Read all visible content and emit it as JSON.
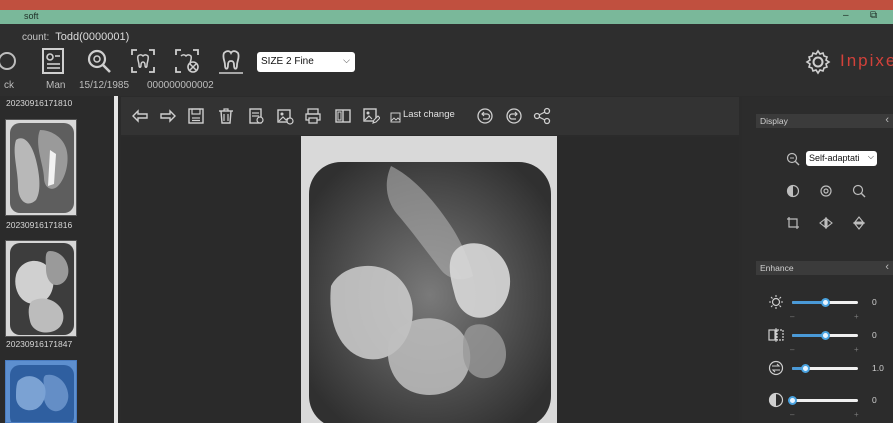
{
  "window": {
    "title": "soft",
    "minimize": "–",
    "restore": "⧉"
  },
  "header": {
    "account_label": "count:",
    "account_name": "Todd(0000001)",
    "size_select": "SIZE 2 Fine",
    "brand": "Inpixe",
    "patient": {
      "back": "ck",
      "gender": "Man",
      "dob": "15/12/1985",
      "id": "000000000002"
    }
  },
  "thumbnails": [
    {
      "caption": "20230916171810"
    },
    {
      "caption": "20230916171816"
    },
    {
      "caption": "20230916171847"
    },
    {
      "caption": ""
    }
  ],
  "toolbar": {
    "icons": [
      "arrow-left-icon",
      "arrow-right-icon",
      "save-icon",
      "trash-icon",
      "report-icon",
      "export-icon",
      "print-icon",
      "compare-icon",
      "edit-image-icon"
    ],
    "last_change_label": "Last change",
    "extra_icons": [
      "undo-icon",
      "redo-icon",
      "share-icon"
    ]
  },
  "display_panel": {
    "title": "Display",
    "select_value": "Self-adaptati",
    "icons": [
      "contrast-icon",
      "focus-icon",
      "zoom-icon",
      "crop-icon",
      "flip-horizontal-icon",
      "flip-vertical-icon"
    ]
  },
  "enhance_panel": {
    "title": "Enhance",
    "sliders": [
      {
        "name": "brightness",
        "icon": "brightness-icon",
        "value": "0",
        "position": 0.5
      },
      {
        "name": "sharpness",
        "icon": "sharpness-icon",
        "value": "0",
        "position": 0.5
      },
      {
        "name": "gamma",
        "icon": "gamma-icon",
        "value": "1.0",
        "position": 0.2
      },
      {
        "name": "contrast",
        "icon": "contrast-icon",
        "value": "0",
        "position": 0.0
      }
    ],
    "minus": "–",
    "plus": "+"
  },
  "colors": {
    "brand": "#d2413a",
    "accent": "#4a9ad8",
    "titlebar": "#7ab89a",
    "topstrip": "#c0503f"
  }
}
